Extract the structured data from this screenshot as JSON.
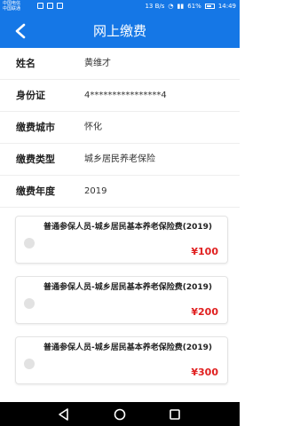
{
  "status_bar": {
    "carrier": "中国电信\n中国联通",
    "network_speed": "13 B/s",
    "battery": "61%",
    "time": "14:49"
  },
  "app_bar": {
    "title": "网上缴费",
    "back_icon": "chevron-left-icon"
  },
  "fields": [
    {
      "label": "姓名",
      "value": "黄维才"
    },
    {
      "label": "身份证",
      "value": "4****************4"
    },
    {
      "label": "缴费城市",
      "value": "怀化"
    },
    {
      "label": "缴费类型",
      "value": "城乡居民养老保险"
    },
    {
      "label": "缴费年度",
      "value": "2019"
    }
  ],
  "fee_options": [
    {
      "name": "普通参保人员-城乡居民基本养老保险费(2019)",
      "price": "¥100",
      "selected": false
    },
    {
      "name": "普通参保人员-城乡居民基本养老保险费(2019)",
      "price": "¥200",
      "selected": false
    },
    {
      "name": "普通参保人员-城乡居民基本养老保险费(2019)",
      "price": "¥300",
      "selected": false
    }
  ],
  "colors": {
    "primary": "#1577e6",
    "price": "#e02020",
    "radio": "#e2e2e2"
  },
  "nav_bar": {
    "icons": [
      "back-triangle-icon",
      "home-circle-icon",
      "recents-square-icon"
    ]
  }
}
